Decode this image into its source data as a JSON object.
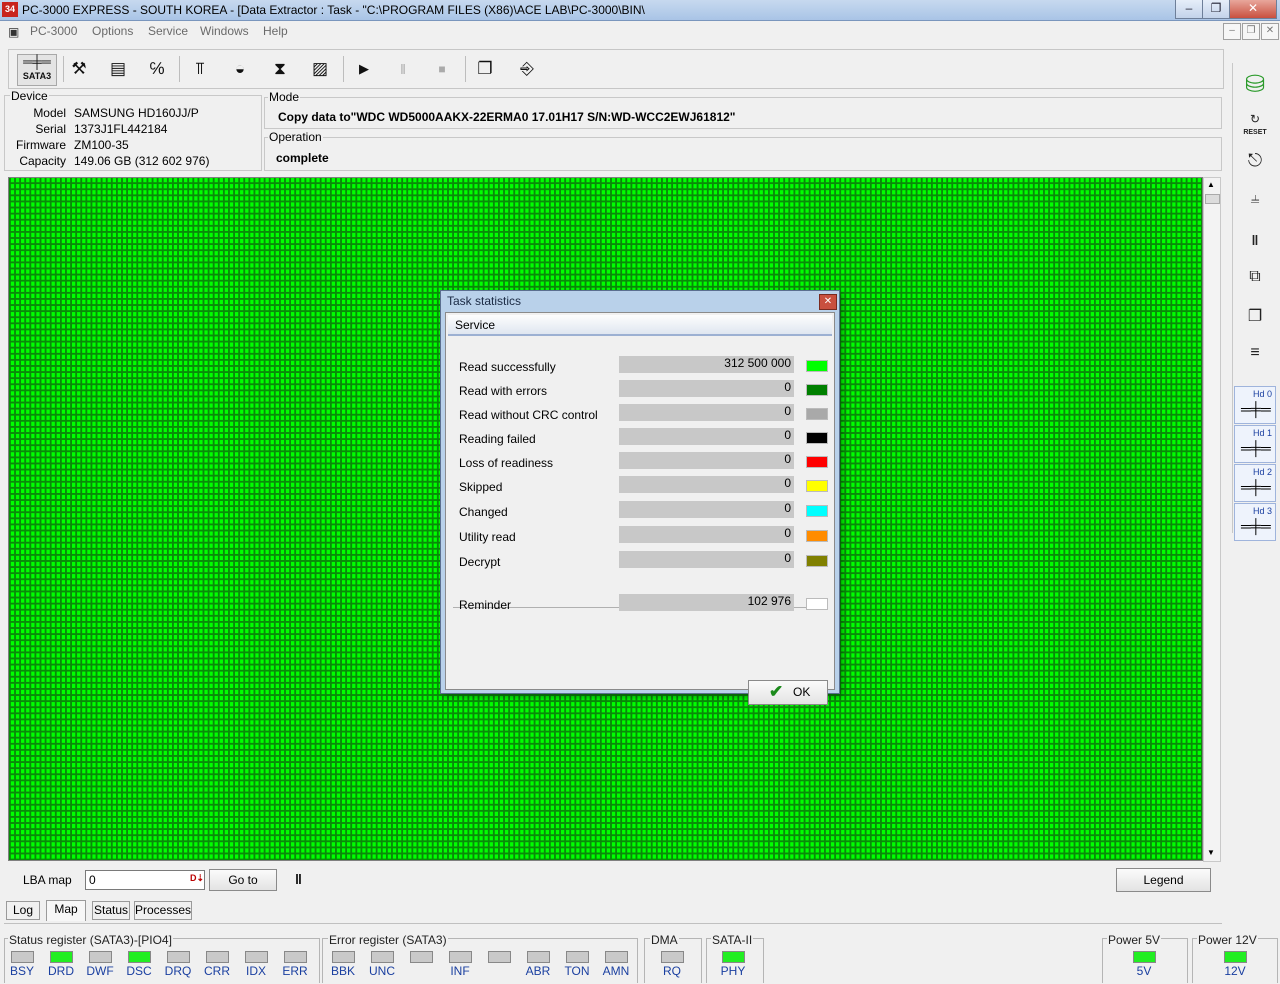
{
  "window": {
    "title": "PC-3000 EXPRESS - SOUTH KOREA - [Data Extractor : Task - \"C:\\PROGRAM FILES (X86)\\ACE LAB\\PC-3000\\BIN\\",
    "app_icon_text": "34"
  },
  "menu": {
    "items": [
      "PC-3000",
      "Options",
      "Service",
      "Windows",
      "Help"
    ]
  },
  "toolbar": {
    "sata_label": "SATA3"
  },
  "device": {
    "title": "Device",
    "model_label": "Model",
    "model": "SAMSUNG HD160JJ/P",
    "serial_label": "Serial",
    "serial": "1373J1FL442184",
    "firmware_label": "Firmware",
    "firmware": "ZM100-35",
    "capacity_label": "Capacity",
    "capacity": "149.06 GB (312 602 976)"
  },
  "mode": {
    "title": "Mode",
    "value": "Copy data to\"WDC WD5000AAKX-22ERMA0 17.01H17 S/N:WD-WCC2EWJ61812\""
  },
  "operation": {
    "title": "Operation",
    "value": "complete"
  },
  "lba": {
    "label": "LBA map",
    "value": "0",
    "goto_label": "Go to",
    "legend_label": "Legend"
  },
  "tabs": [
    "Log",
    "Map",
    "Status",
    "Processes"
  ],
  "dialog": {
    "title": "Task statistics",
    "section": "Service",
    "rows": [
      {
        "label": "Read successfully",
        "value": "312 500 000",
        "color": "#00ff00"
      },
      {
        "label": "Read with errors",
        "value": "0",
        "color": "#008000"
      },
      {
        "label": "Read without CRC control",
        "value": "0",
        "color": "#a9a9a9"
      },
      {
        "label": "Reading failed",
        "value": "0",
        "color": "#000000"
      },
      {
        "label": "Loss of readiness",
        "value": "0",
        "color": "#ff0000"
      },
      {
        "label": "Skipped",
        "value": "0",
        "color": "#ffff00"
      },
      {
        "label": "Changed",
        "value": "0",
        "color": "#00ffff"
      },
      {
        "label": "Utility read",
        "value": "0",
        "color": "#ff8c00"
      },
      {
        "label": "Decrypt",
        "value": "0",
        "color": "#808000"
      }
    ],
    "reminder": {
      "label": "Reminder",
      "value": "102 976",
      "color": "#ffffff"
    },
    "ok_label": "OK"
  },
  "status": {
    "status_register": {
      "title": "Status register (SATA3)-[PIO4]",
      "leds": [
        {
          "label": "BSY",
          "on": false
        },
        {
          "label": "DRD",
          "on": true
        },
        {
          "label": "DWF",
          "on": false
        },
        {
          "label": "DSC",
          "on": true
        },
        {
          "label": "DRQ",
          "on": false
        },
        {
          "label": "CRR",
          "on": false
        },
        {
          "label": "IDX",
          "on": false
        },
        {
          "label": "ERR",
          "on": false
        }
      ]
    },
    "error_register": {
      "title": "Error register (SATA3)",
      "leds": [
        {
          "label": "BBK",
          "on": false
        },
        {
          "label": "UNC",
          "on": false
        },
        {
          "label": "",
          "on": false
        },
        {
          "label": "INF",
          "on": false
        },
        {
          "label": "",
          "on": false
        },
        {
          "label": "ABR",
          "on": false
        },
        {
          "label": "TON",
          "on": false
        },
        {
          "label": "AMN",
          "on": false
        }
      ]
    },
    "dma": {
      "title": "DMA",
      "label": "RQ",
      "on": false
    },
    "sata2": {
      "title": "SATA-II",
      "label": "PHY",
      "on": true
    },
    "power5": {
      "title": "Power 5V",
      "label": "5V",
      "on": true
    },
    "power12": {
      "title": "Power 12V",
      "label": "12V",
      "on": true
    }
  },
  "right_panel": {
    "reset_label": "RESET",
    "hd_labels": [
      "Hd 0",
      "Hd 1",
      "Hd 2",
      "Hd 3"
    ]
  }
}
